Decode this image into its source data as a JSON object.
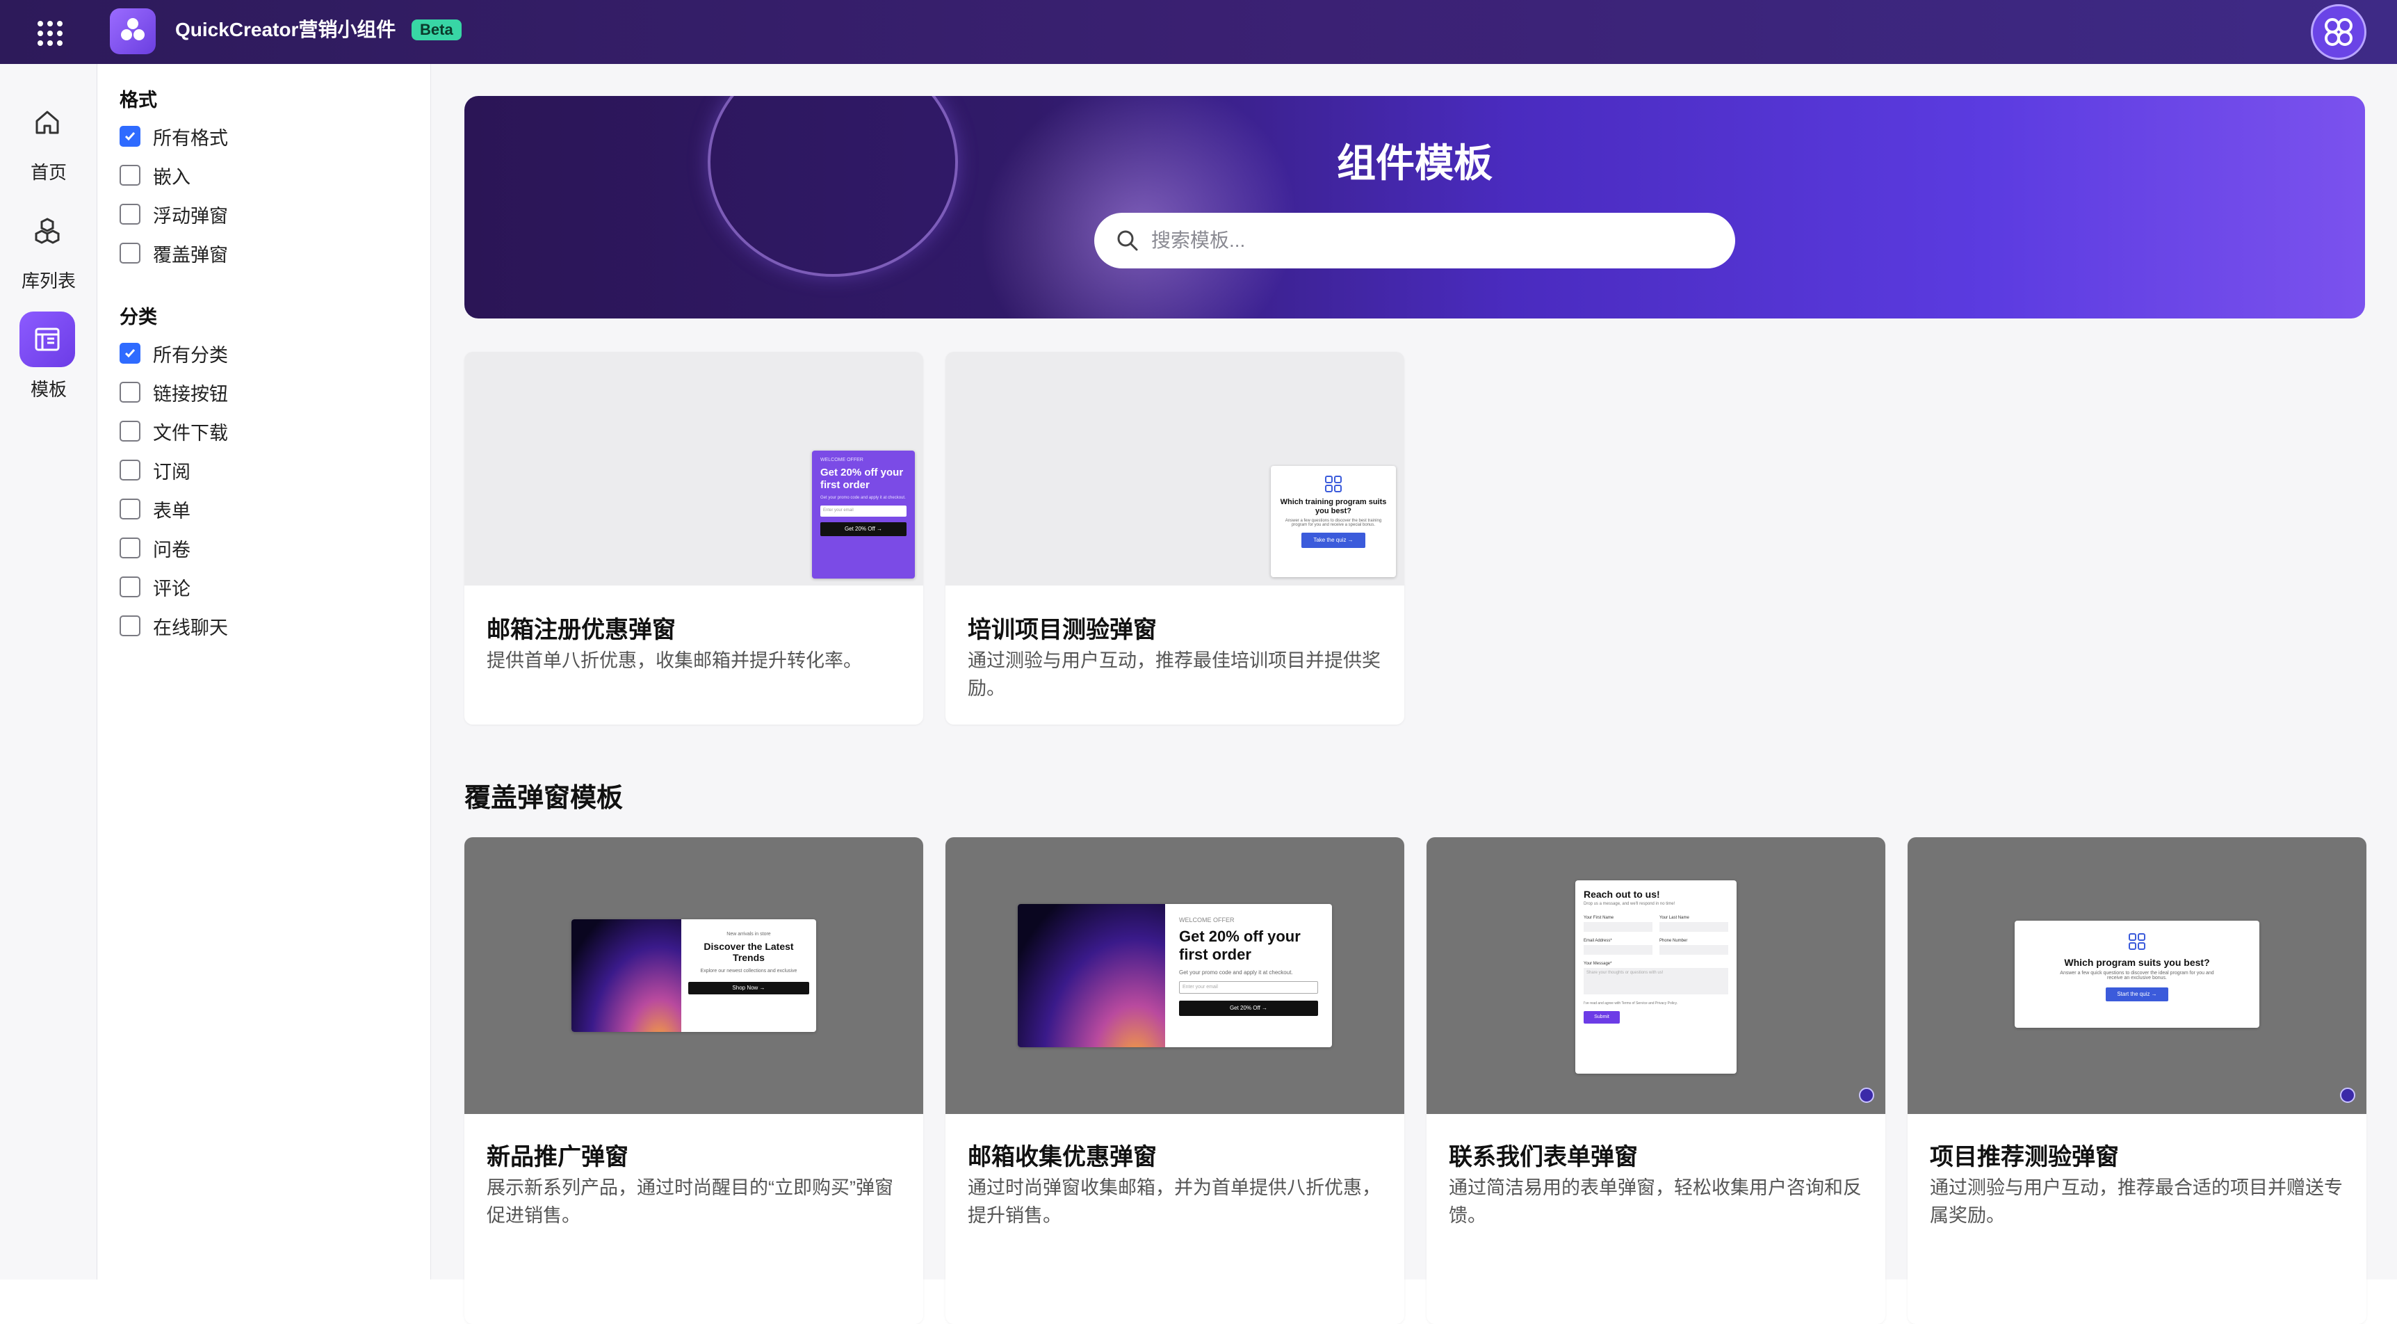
{
  "app": {
    "title": "QuickCreator营销小组件",
    "badge": "Beta"
  },
  "nav": [
    {
      "label": "首页",
      "icon": "home-icon"
    },
    {
      "label": "库列表",
      "icon": "cubes-icon"
    },
    {
      "label": "模板",
      "icon": "template-icon",
      "active": true
    }
  ],
  "filters": {
    "format": {
      "title": "格式",
      "options": [
        {
          "label": "所有格式",
          "checked": true
        },
        {
          "label": "嵌入",
          "checked": false
        },
        {
          "label": "浮动弹窗",
          "checked": false
        },
        {
          "label": "覆盖弹窗",
          "checked": false
        }
      ]
    },
    "category": {
      "title": "分类",
      "options": [
        {
          "label": "所有分类",
          "checked": true
        },
        {
          "label": "链接按钮",
          "checked": false
        },
        {
          "label": "文件下载",
          "checked": false
        },
        {
          "label": "订阅",
          "checked": false
        },
        {
          "label": "表单",
          "checked": false
        },
        {
          "label": "问卷",
          "checked": false
        },
        {
          "label": "评论",
          "checked": false
        },
        {
          "label": "在线聊天",
          "checked": false
        }
      ]
    }
  },
  "hero": {
    "title": "组件模板",
    "search_placeholder": "搜索模板..."
  },
  "floating_cards": [
    {
      "title": "邮箱注册优惠弹窗",
      "desc": "提供首单八折优惠，收集邮箱并提升转化率。",
      "preview": {
        "kicker": "WELCOME OFFER",
        "headline": "Get 20% off your first order",
        "sub": "Get your promo code and apply it at checkout.",
        "input": "Enter your email",
        "button": "Get 20% Off →"
      }
    },
    {
      "title": "培训项目测验弹窗",
      "desc": "通过测验与用户互动，推荐最佳培训项目并提供奖励。",
      "preview": {
        "headline": "Which training program suits you best?",
        "sub": "Answer a few questions to discover the best training program for you and receive a special bonus.",
        "button": "Take the quiz →"
      }
    }
  ],
  "section_overlay": "覆盖弹窗模板",
  "overlay_cards": [
    {
      "title": "新品推广弹窗",
      "desc": "展示新系列产品，通过时尚醒目的“立即购买”弹窗促进销售。",
      "preview": {
        "kicker": "New arrivals in store",
        "headline": "Discover the Latest Trends",
        "sub": "Explore our newest collections and exclusive",
        "button": "Shop Now →"
      }
    },
    {
      "title": "邮箱收集优惠弹窗",
      "desc": "通过时尚弹窗收集邮箱，并为首单提供八折优惠，提升销售。",
      "preview": {
        "kicker": "WELCOME OFFER",
        "headline": "Get 20% off your first order",
        "sub": "Get your promo code and apply it at checkout.",
        "input": "Enter your email",
        "button": "Get 20% Off →"
      }
    },
    {
      "title": "联系我们表单弹窗",
      "desc": "通过简洁易用的表单弹窗，轻松收集用户咨询和反馈。",
      "preview": {
        "headline": "Reach out to us!",
        "sub": "Drop us a message, and we'll respond in no time!",
        "first": "Your First Name",
        "last": "Your Last Name",
        "email": "Email Address*",
        "phone": "Phone Number",
        "message": "Your Message*",
        "placeholder": "Share your thoughts or questions with us!",
        "agree": "I've read and agree with Terms of Service and Privacy Policy.",
        "button": "Submit"
      }
    },
    {
      "title": "项目推荐测验弹窗",
      "desc": "通过测验与用户互动，推荐最合适的项目并赠送专属奖励。",
      "preview": {
        "headline": "Which program suits you best?",
        "sub": "Answer a few quick questions to discover the ideal program for you and receive an exclusive bonus.",
        "button": "Start the quiz →"
      }
    }
  ],
  "colors": {
    "accent": "#6c3ce6",
    "checkbox": "#2f6bff",
    "topbar": "#2d1a5a"
  }
}
